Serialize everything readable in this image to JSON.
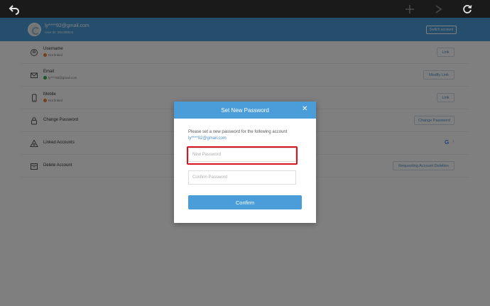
{
  "topbar": {
    "back_icon": "back-arrow-icon",
    "nav_icons": [
      "dim-nav-icon",
      "dim-nav-icon"
    ],
    "refresh_icon": "refresh-icon"
  },
  "header": {
    "email": "ly****92@gmail.com",
    "user_id": "User ID: 291208824",
    "switch_label": "Switch account"
  },
  "rows": [
    {
      "label": "Username",
      "sub": "Not linked",
      "sub_color": "#e8843a",
      "button": "Link",
      "icon": "username-icon"
    },
    {
      "label": "Email",
      "sub": "ly****92@gmail.com",
      "sub_color": "#2fae4f",
      "button": "Modify Link",
      "icon": "email-icon"
    },
    {
      "label": "Mobile",
      "sub": "Not linked",
      "sub_color": "#e8843a",
      "button": "Link",
      "icon": "mobile-icon"
    },
    {
      "label": "Change Password",
      "button": "Change Password",
      "icon": "lock-icon"
    },
    {
      "label": "Linked Accounts",
      "icon": "linked-accounts-icon"
    },
    {
      "label": "Delete Account",
      "button": "Requesting Account Deletion",
      "icon": "calendar-delete-icon"
    }
  ],
  "modal": {
    "title": "Set New Password",
    "close": "✕",
    "instruction": "Please set a new password for the following account",
    "account": "ly****92@gmail.com",
    "new_password_placeholder": "New Password",
    "confirm_password_placeholder": "Confirm Password",
    "confirm_label": "Confirm"
  },
  "colors": {
    "accent": "#4a9dd8",
    "highlight": "#d8141c",
    "link": "#4a8fc9"
  }
}
